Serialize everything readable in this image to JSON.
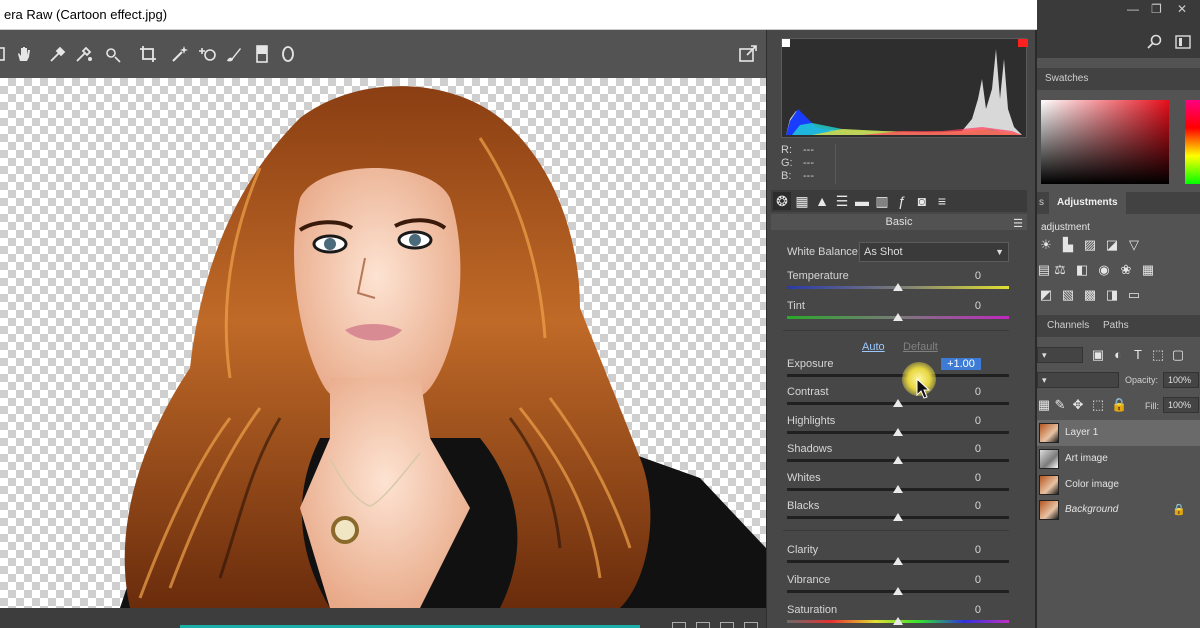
{
  "window": {
    "title": "era Raw (Cartoon effect.jpg)"
  },
  "histogram": {
    "r_label": "R:",
    "g_label": "G:",
    "b_label": "B:",
    "r": "---",
    "g": "---",
    "b": "---"
  },
  "panel": {
    "title": "Basic",
    "white_balance": {
      "label": "White Balance:",
      "value": "As Shot"
    },
    "auto_label": "Auto",
    "default_label": "Default",
    "sliders": [
      {
        "label": "Temperature",
        "value": "0",
        "position": 0.5
      },
      {
        "label": "Tint",
        "value": "0",
        "position": 0.5
      },
      {
        "label": "Exposure",
        "value": "+1.00",
        "position": 0.6
      },
      {
        "label": "Contrast",
        "value": "0",
        "position": 0.5
      },
      {
        "label": "Highlights",
        "value": "0",
        "position": 0.5
      },
      {
        "label": "Shadows",
        "value": "0",
        "position": 0.5
      },
      {
        "label": "Whites",
        "value": "0",
        "position": 0.5
      },
      {
        "label": "Blacks",
        "value": "0",
        "position": 0.5
      },
      {
        "label": "Clarity",
        "value": "0",
        "position": 0.5
      },
      {
        "label": "Vibrance",
        "value": "0",
        "position": 0.5
      },
      {
        "label": "Saturation",
        "value": "0",
        "position": 0.5
      }
    ]
  },
  "photoshop": {
    "swatches_tab": "Swatches",
    "adjustments_tab": "Adjustments",
    "adjustments_partial_tab": "s",
    "adjustment_heading": "adjustment",
    "channels_tab": "Channels",
    "paths_tab": "Paths",
    "opacity_label": "Opacity:",
    "opacity_value": "100%",
    "fill_label": "Fill:",
    "fill_value": "100%",
    "layers": [
      {
        "name": "Layer 1",
        "selected": true
      },
      {
        "name": "Art image",
        "selected": false
      },
      {
        "name": "Color image",
        "selected": false
      },
      {
        "name": "Background",
        "selected": false
      }
    ]
  }
}
